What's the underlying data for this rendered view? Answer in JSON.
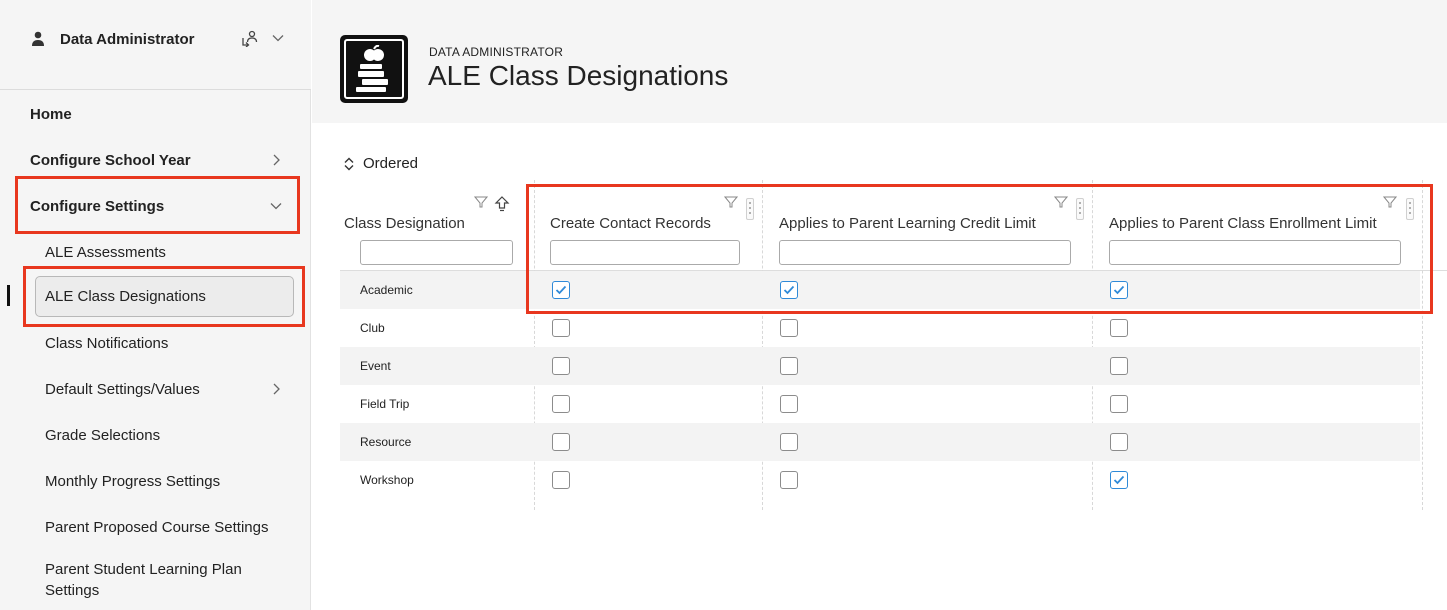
{
  "sidebar": {
    "user_name": "Data Administrator",
    "items": [
      {
        "label": "Home"
      },
      {
        "label": "Configure School Year"
      },
      {
        "label": "Configure Settings"
      },
      {
        "label": "ALE Assessments"
      },
      {
        "label": "ALE Class Designations"
      },
      {
        "label": "Class Notifications"
      },
      {
        "label": "Default Settings/Values"
      },
      {
        "label": "Grade Selections"
      },
      {
        "label": "Monthly Progress Settings"
      },
      {
        "label": "Parent Proposed Course Settings"
      },
      {
        "label": "Parent Student Learning Plan Settings"
      }
    ]
  },
  "header": {
    "overline": "DATA ADMINISTRATOR",
    "title": "ALE Class Designations"
  },
  "toolbar": {
    "sort_label": "Ordered"
  },
  "grid": {
    "columns": [
      {
        "label": "Class Designation"
      },
      {
        "label": "Create Contact Records"
      },
      {
        "label": "Applies to Parent Learning Credit Limit"
      },
      {
        "label": "Applies to Parent Class Enrollment Limit"
      }
    ],
    "rows": [
      {
        "name": "Academic",
        "create_contact": true,
        "learning_credit": true,
        "class_enrollment": true
      },
      {
        "name": "Club",
        "create_contact": false,
        "learning_credit": false,
        "class_enrollment": false
      },
      {
        "name": "Event",
        "create_contact": false,
        "learning_credit": false,
        "class_enrollment": false
      },
      {
        "name": "Field Trip",
        "create_contact": false,
        "learning_credit": false,
        "class_enrollment": false
      },
      {
        "name": "Resource",
        "create_contact": false,
        "learning_credit": false,
        "class_enrollment": false
      },
      {
        "name": "Workshop",
        "create_contact": false,
        "learning_credit": false,
        "class_enrollment": true
      }
    ]
  },
  "colors": {
    "highlight": "#e8371f",
    "checkbox_checked": "#2f8ad8"
  },
  "icons": {
    "user": "user-icon",
    "switch": "switch-role-icon",
    "chevron": "chevron-icon",
    "filter": "filter-icon",
    "sort": "sort-icon",
    "upload": "upload-icon",
    "logo": "apple-books-logo"
  }
}
